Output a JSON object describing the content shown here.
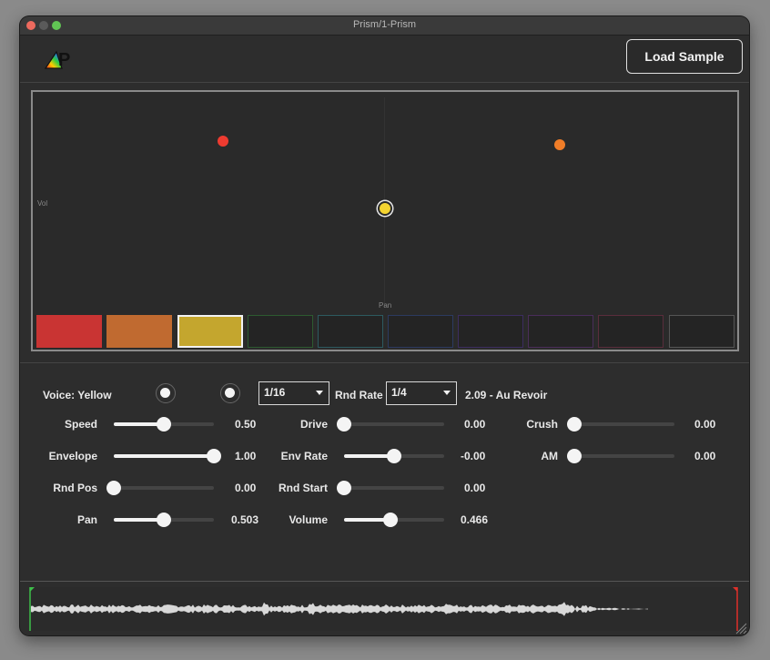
{
  "window": {
    "title": "Prism/1-Prism"
  },
  "header": {
    "logo_text": "P",
    "load_button": "Load Sample"
  },
  "xy_pad": {
    "x_axis_label": "Pan",
    "y_axis_label": "Vol",
    "voices": [
      {
        "name": "Red",
        "color": "#c93433"
      },
      {
        "name": "Orange",
        "color": "#c06a30"
      },
      {
        "name": "Yellow",
        "color": "#c4a62e",
        "selected": true
      },
      {
        "name": "Green",
        "color": "#2d5a30"
      },
      {
        "name": "Teal",
        "color": "#2d5a60"
      },
      {
        "name": "Blue",
        "color": "#2c3a60"
      },
      {
        "name": "Indigo",
        "color": "#3c2d60"
      },
      {
        "name": "Violet",
        "color": "#4a2d5a"
      },
      {
        "name": "Rose",
        "color": "#5a2d3c"
      },
      {
        "name": "Gray",
        "color": "#555555"
      }
    ]
  },
  "voice_bar": {
    "voice_label": "Voice: Yellow",
    "division_select": "1/16",
    "rnd_rate_label": "Rnd Rate",
    "rnd_rate_select": "1/4",
    "preset_readout": "2.09 - Au Revoir"
  },
  "controls": {
    "speed": {
      "label": "Speed",
      "value": "0.50",
      "level": 0.5
    },
    "envelope": {
      "label": "Envelope",
      "value": "1.00",
      "level": 1.0
    },
    "rnd_pos": {
      "label": "Rnd Pos",
      "value": "0.00",
      "level": 0.0
    },
    "pan": {
      "label": "Pan",
      "value": "0.503",
      "level": 0.503
    },
    "drive": {
      "label": "Drive",
      "value": "0.00",
      "level": 0.0
    },
    "env_rate": {
      "label": "Env Rate",
      "value": "-0.00",
      "level": 0.5
    },
    "rnd_start": {
      "label": "Rnd Start",
      "value": "0.00",
      "level": 0.0
    },
    "volume": {
      "label": "Volume",
      "value": "0.466",
      "level": 0.466
    },
    "crush": {
      "label": "Crush",
      "value": "0.00",
      "level": 0.0
    },
    "am": {
      "label": "AM",
      "value": "0.00",
      "level": 0.0
    }
  }
}
